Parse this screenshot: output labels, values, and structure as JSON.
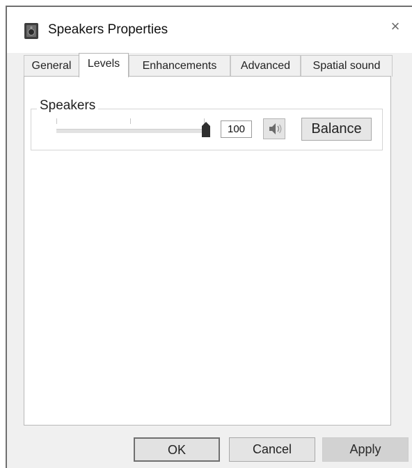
{
  "window": {
    "title": "Speakers Properties",
    "close_glyph": "×",
    "icon": "speaker-device-icon"
  },
  "tabs": [
    {
      "label": "General",
      "active": false
    },
    {
      "label": "Levels",
      "active": true
    },
    {
      "label": "Enhancements",
      "active": false
    },
    {
      "label": "Advanced",
      "active": false
    },
    {
      "label": "Spatial sound",
      "active": false
    }
  ],
  "levels": {
    "group_title": "Speakers",
    "volume_value": "100",
    "volume_level_percent": 100,
    "mute_icon": "speaker-volume-icon",
    "balance_label": "Balance"
  },
  "footer": {
    "ok_label": "OK",
    "cancel_label": "Cancel",
    "apply_label": "Apply",
    "apply_enabled": false
  }
}
